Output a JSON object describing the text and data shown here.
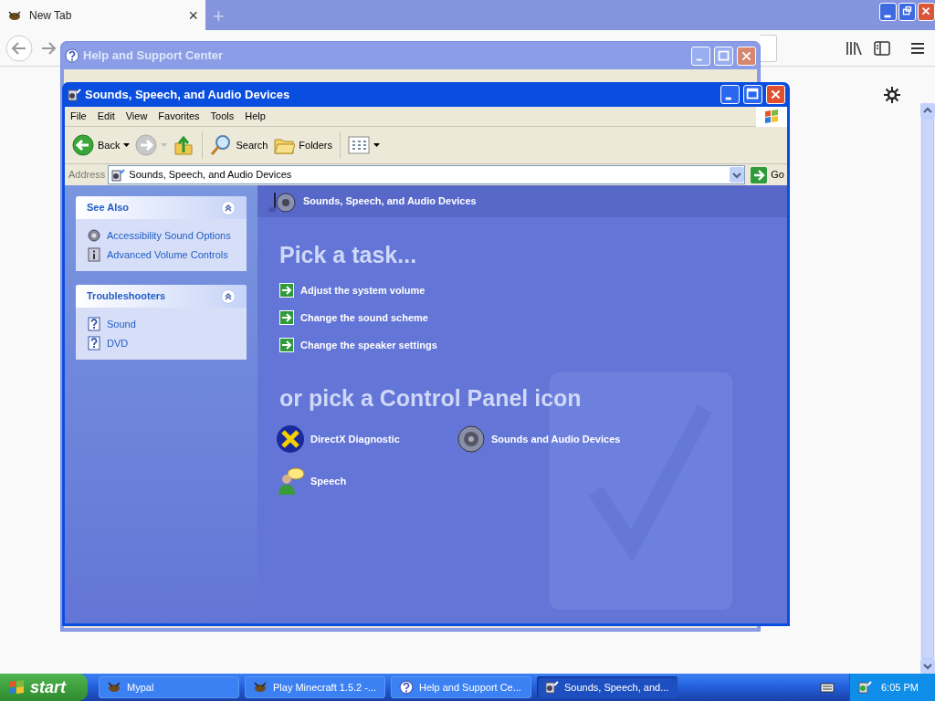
{
  "browser": {
    "tab": {
      "title": "New Tab",
      "close": "×"
    },
    "new_tab": "+"
  },
  "help_window": {
    "title": "Help and Support Center"
  },
  "window": {
    "title": "Sounds, Speech, and Audio Devices",
    "menu": [
      "File",
      "Edit",
      "View",
      "Favorites",
      "Tools",
      "Help"
    ],
    "toolbar": [
      {
        "kind": "back",
        "label": "Back"
      },
      {
        "kind": "forward"
      },
      {
        "kind": "up"
      },
      {
        "kind": "search",
        "label": "Search"
      },
      {
        "kind": "folders",
        "label": "Folders"
      },
      {
        "kind": "views"
      }
    ],
    "address": {
      "label": "Address",
      "value": "Sounds, Speech, and Audio Devices",
      "go": "Go"
    },
    "sidebar": [
      {
        "title": "See Also",
        "expanded": true,
        "items": [
          {
            "kind": "sound-options",
            "label": "Accessibility Sound Options"
          },
          {
            "kind": "info",
            "label": "Advanced Volume Controls"
          }
        ]
      },
      {
        "title": "Troubleshooters",
        "expanded": true,
        "items": [
          {
            "kind": "help",
            "label": "Sound"
          },
          {
            "kind": "help",
            "label": "DVD"
          }
        ]
      }
    ],
    "header": "Sounds, Speech, and Audio Devices",
    "task_heading": "Pick a task...",
    "tasks": [
      "Adjust the system volume",
      "Change the sound scheme",
      "Change the speaker settings"
    ],
    "icons_heading": "or pick a Control Panel icon",
    "icons": [
      {
        "kind": "directx",
        "label": "DirectX Diagnostic"
      },
      {
        "kind": "speaker",
        "label": "Sounds and Audio Devices"
      },
      {
        "kind": "speech",
        "label": "Speech"
      }
    ]
  },
  "taskbar": {
    "start": "start",
    "tasks": [
      {
        "kind": "app",
        "label": "Mypal",
        "selected": false
      },
      {
        "kind": "app",
        "label": "Play Minecraft 1.5.2 -...",
        "selected": false
      },
      {
        "kind": "help",
        "label": "Help and Support Ce...",
        "selected": false
      },
      {
        "kind": "folder",
        "label": "Sounds, Speech, and...",
        "selected": true
      }
    ],
    "clock": "6:05 PM"
  }
}
